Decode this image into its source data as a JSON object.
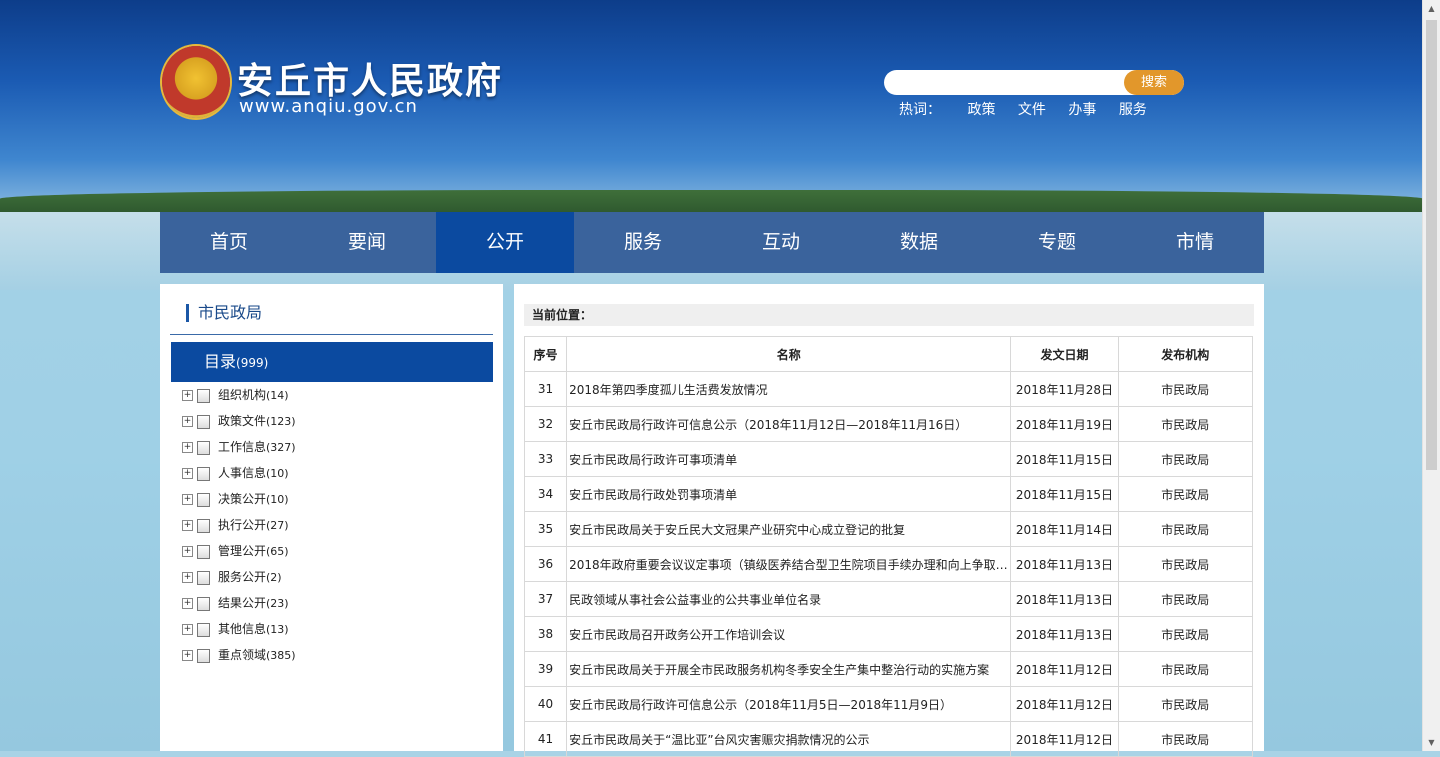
{
  "header": {
    "site_title": "安丘市人民政府",
    "site_url": "www.anqiu.gov.cn",
    "search": {
      "placeholder": "",
      "button_label": "搜索"
    },
    "hotwords": {
      "label": "热词：",
      "items": [
        "政策",
        "文件",
        "办事",
        "服务"
      ]
    }
  },
  "nav": {
    "items": [
      "首页",
      "要闻",
      "公开",
      "服务",
      "互动",
      "数据",
      "专题",
      "市情"
    ],
    "active": "公开"
  },
  "sidebar": {
    "title": "市民政局",
    "catalog_label": "目录",
    "catalog_count": "(999)",
    "items": [
      {
        "label": "组织机构",
        "count": "(14)"
      },
      {
        "label": "政策文件",
        "count": "(123)"
      },
      {
        "label": "工作信息",
        "count": "(327)"
      },
      {
        "label": "人事信息",
        "count": "(10)"
      },
      {
        "label": "决策公开",
        "count": "(10)"
      },
      {
        "label": "执行公开",
        "count": "(27)"
      },
      {
        "label": "管理公开",
        "count": "(65)"
      },
      {
        "label": "服务公开",
        "count": "(2)"
      },
      {
        "label": "结果公开",
        "count": "(23)"
      },
      {
        "label": "其他信息",
        "count": "(13)"
      },
      {
        "label": "重点领域",
        "count": "(385)"
      }
    ]
  },
  "main": {
    "breadcrumb_label": "当前位置：",
    "table": {
      "headers": [
        "序号",
        "名称",
        "发文日期",
        "发布机构"
      ],
      "rows": [
        [
          "31",
          "2018年第四季度孤儿生活费发放情况",
          "2018年11月28日",
          "市民政局"
        ],
        [
          "32",
          "安丘市民政局行政许可信息公示（2018年11月12日—2018年11月16日）",
          "2018年11月19日",
          "市民政局"
        ],
        [
          "33",
          "安丘市民政局行政许可事项清单",
          "2018年11月15日",
          "市民政局"
        ],
        [
          "34",
          "安丘市民政局行政处罚事项清单",
          "2018年11月15日",
          "市民政局"
        ],
        [
          "35",
          "安丘市民政局关于安丘民大文冠果产业研究中心成立登记的批复",
          "2018年11月14日",
          "市民政局"
        ],
        [
          "36",
          "2018年政府重要会议议定事项（镇级医养结合型卫生院项目手续办理和向上争取…",
          "2018年11月13日",
          "市民政局"
        ],
        [
          "37",
          "民政领域从事社会公益事业的公共事业单位名录",
          "2018年11月13日",
          "市民政局"
        ],
        [
          "38",
          "安丘市民政局召开政务公开工作培训会议",
          "2018年11月13日",
          "市民政局"
        ],
        [
          "39",
          "安丘市民政局关于开展全市民政服务机构冬季安全生产集中整治行动的实施方案",
          "2018年11月12日",
          "市民政局"
        ],
        [
          "40",
          "安丘市民政局行政许可信息公示（2018年11月5日—2018年11月9日）",
          "2018年11月12日",
          "市民政局"
        ],
        [
          "41",
          "安丘市民政局关于“温比亚”台风灾害赈灾捐款情况的公示",
          "2018年11月12日",
          "市民政局"
        ]
      ]
    }
  },
  "colors": {
    "nav_bg": "#3a639c",
    "nav_active": "#0b4aa0",
    "search_button": "#e2972b",
    "title_accent": "#1a4a8a"
  }
}
